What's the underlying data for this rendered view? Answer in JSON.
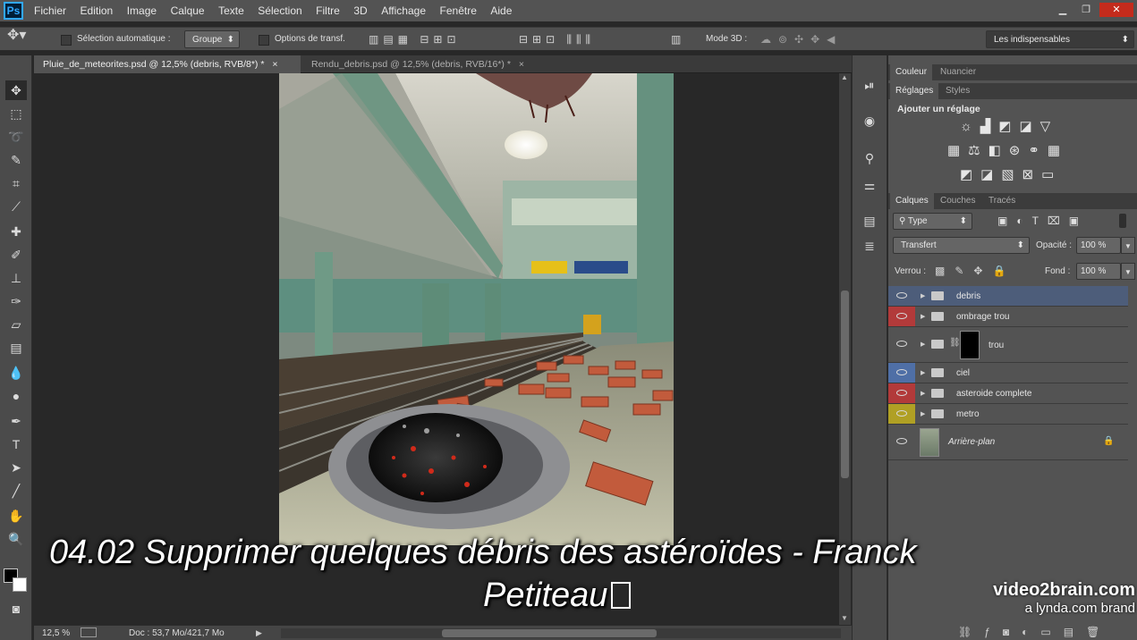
{
  "app": {
    "logo": "Ps"
  },
  "menubar": [
    "Fichier",
    "Edition",
    "Image",
    "Calque",
    "Texte",
    "Sélection",
    "Filtre",
    "3D",
    "Affichage",
    "Fenêtre",
    "Aide"
  ],
  "options": {
    "auto_select_label": "Sélection automatique :",
    "auto_select_value": "Groupe",
    "transform_label": "Options de transf.",
    "mode3d_label": "Mode 3D :",
    "workspace": "Les indispensables"
  },
  "tabs": [
    {
      "label": "Pluie_de_meteorites.psd @ 12,5% (debris, RVB/8*) *",
      "close": "×"
    },
    {
      "label": "Rendu_debris.psd @ 12,5% (debris, RVB/16*) *",
      "close": "×"
    }
  ],
  "status": {
    "zoom": "12,5 %",
    "doc": "Doc : 53,7 Mo/421,7 Mo"
  },
  "panels": {
    "color_tabs": [
      "Couleur",
      "Nuancier"
    ],
    "adjust_tabs": [
      "Réglages",
      "Styles"
    ],
    "add_adjustment": "Ajouter un réglage",
    "layers_tabs": [
      "Calques",
      "Couches",
      "Tracés"
    ],
    "filter_type": "Type",
    "blend_mode": "Transfert",
    "opacity_label": "Opacité :",
    "opacity_value": "100 %",
    "lock_label": "Verrou :",
    "fill_label": "Fond :",
    "fill_value": "100 %"
  },
  "layers": [
    {
      "name": "debris",
      "tag_color": "#4d5d7a",
      "selected": true
    },
    {
      "name": "ombrage trou",
      "tag_color": "#b23a3a"
    },
    {
      "name": "trou",
      "tag_color": ""
    },
    {
      "name": "ciel",
      "tag_color": "#4f6fa6"
    },
    {
      "name": "asteroide complete",
      "tag_color": "#b23a3a"
    },
    {
      "name": "metro",
      "tag_color": "#b0a024"
    },
    {
      "name": "Arrière-plan",
      "tag_color": ""
    }
  ],
  "subtitle": {
    "line1": "04.02 Supprimer quelques débris des astéroïdes - Franck",
    "line2": "Petiteau"
  },
  "watermark": {
    "brand": "video2brain.com",
    "sub": "a lynda.com brand"
  },
  "colors": {
    "accent": "#31a8ff",
    "selected_layer": "#4d5d7a"
  }
}
